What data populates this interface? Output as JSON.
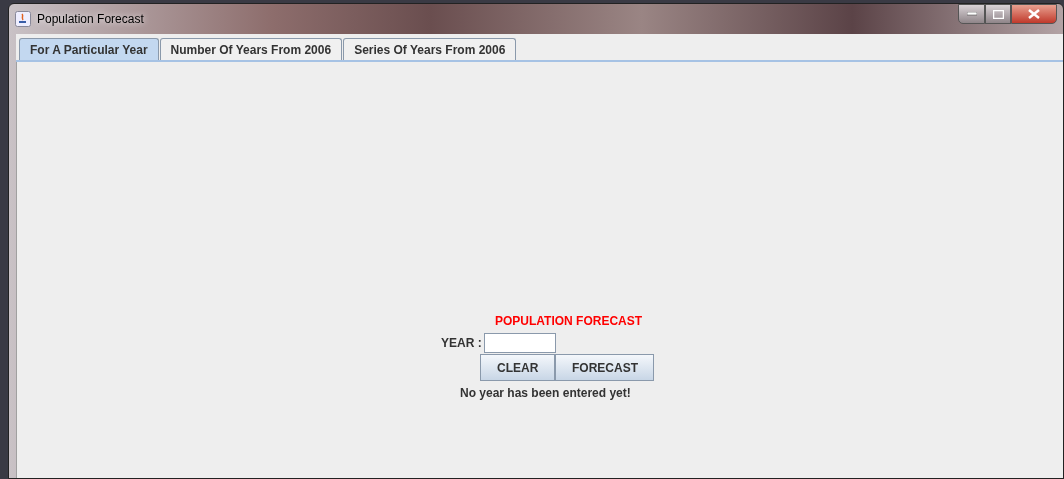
{
  "window": {
    "title": "Population Forecast"
  },
  "tabs": [
    {
      "label": "For A Particular Year",
      "selected": true
    },
    {
      "label": "Number Of Years From 2006",
      "selected": false
    },
    {
      "label": "Series Of Years From 2006",
      "selected": false
    }
  ],
  "form": {
    "title": "POPULATION FORECAST",
    "year_label": "YEAR :",
    "buttons": [
      "CLEAR",
      "FORECAST"
    ],
    "message": "No year has been entered yet!"
  }
}
